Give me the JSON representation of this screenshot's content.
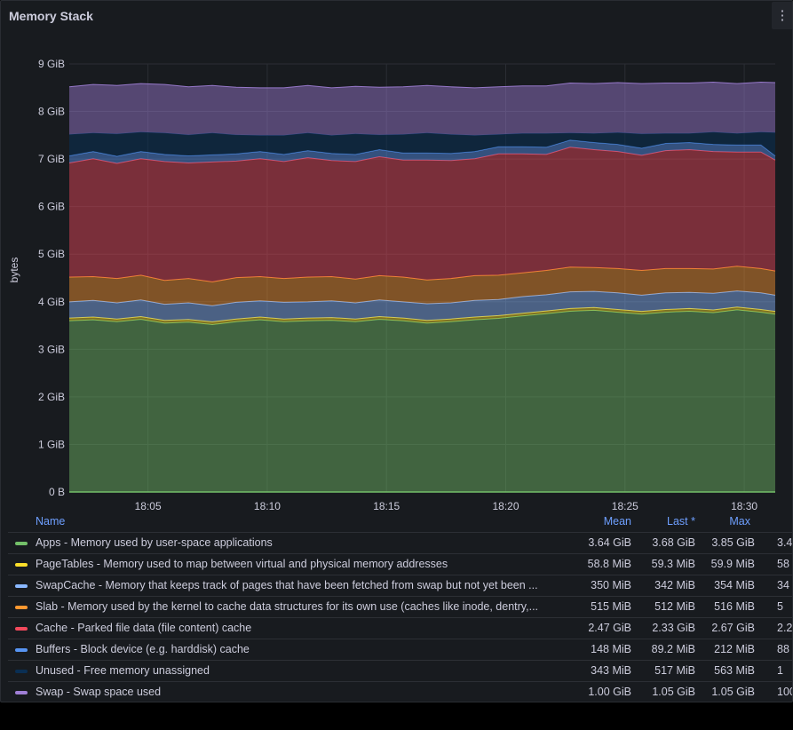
{
  "panel": {
    "title": "Memory Stack",
    "menu_icon": "⋮"
  },
  "chart_data": {
    "type": "area",
    "stacked": true,
    "ylabel": "bytes",
    "yunit": "GiB",
    "ylim": [
      0,
      9
    ],
    "y_ticks": [
      "0 B",
      "1 GiB",
      "2 GiB",
      "3 GiB",
      "4 GiB",
      "5 GiB",
      "6 GiB",
      "7 GiB",
      "8 GiB",
      "9 GiB"
    ],
    "x_ticks": [
      "18:05",
      "18:10",
      "18:15",
      "18:20",
      "18:25",
      "18:30"
    ],
    "x_tick_minutes": [
      65,
      70,
      75,
      80,
      85,
      90
    ],
    "x_range_minutes": [
      61.7,
      91.3
    ],
    "x_minutes": [
      61.7,
      62.7,
      63.7,
      64.7,
      65.7,
      66.7,
      67.7,
      68.7,
      69.7,
      70.7,
      71.7,
      72.7,
      73.7,
      74.7,
      75.7,
      76.7,
      77.7,
      78.7,
      79.7,
      80.7,
      81.7,
      82.7,
      83.7,
      84.7,
      85.7,
      86.7,
      87.7,
      88.7,
      89.7,
      90.7,
      91.3
    ],
    "grid": true,
    "legend_placement": "bottom",
    "series": [
      {
        "name": "Apps - Memory used by user-space applications",
        "color": "#73bf69",
        "values": [
          3.6,
          3.62,
          3.58,
          3.63,
          3.55,
          3.57,
          3.52,
          3.58,
          3.62,
          3.58,
          3.6,
          3.61,
          3.58,
          3.63,
          3.6,
          3.55,
          3.58,
          3.62,
          3.65,
          3.7,
          3.75,
          3.8,
          3.82,
          3.78,
          3.74,
          3.78,
          3.8,
          3.77,
          3.83,
          3.78,
          3.74
        ]
      },
      {
        "name": "PageTables - Memory used to map between virtual and physical memory addresses",
        "color": "#fade2a",
        "values": [
          0.058,
          0.058,
          0.058,
          0.058,
          0.058,
          0.058,
          0.058,
          0.058,
          0.058,
          0.058,
          0.058,
          0.058,
          0.058,
          0.058,
          0.058,
          0.058,
          0.058,
          0.058,
          0.058,
          0.058,
          0.058,
          0.058,
          0.058,
          0.058,
          0.058,
          0.058,
          0.058,
          0.058,
          0.058,
          0.058,
          0.058
        ]
      },
      {
        "name": "SwapCache - Memory that keeps track of pages that have been fetched from swap but not yet been ...",
        "color": "#8ab8ff",
        "values": [
          0.34,
          0.35,
          0.34,
          0.35,
          0.34,
          0.35,
          0.34,
          0.35,
          0.34,
          0.35,
          0.34,
          0.35,
          0.34,
          0.35,
          0.34,
          0.35,
          0.34,
          0.35,
          0.34,
          0.35,
          0.34,
          0.35,
          0.34,
          0.35,
          0.34,
          0.35,
          0.34,
          0.35,
          0.34,
          0.35,
          0.34
        ]
      },
      {
        "name": "Slab - Memory used by the kernel to cache data structures for its own use (caches like inode, dentry,...",
        "color": "#ff9830",
        "values": [
          0.52,
          0.5,
          0.51,
          0.52,
          0.5,
          0.51,
          0.5,
          0.52,
          0.51,
          0.5,
          0.52,
          0.51,
          0.5,
          0.51,
          0.52,
          0.5,
          0.51,
          0.52,
          0.51,
          0.5,
          0.51,
          0.52,
          0.5,
          0.51,
          0.52,
          0.51,
          0.5,
          0.51,
          0.52,
          0.51,
          0.51
        ]
      },
      {
        "name": "Cache - Parked file data (file content) cache",
        "color": "#f2495c",
        "values": [
          2.4,
          2.48,
          2.42,
          2.45,
          2.5,
          2.43,
          2.52,
          2.45,
          2.48,
          2.46,
          2.51,
          2.44,
          2.47,
          2.5,
          2.46,
          2.52,
          2.48,
          2.46,
          2.55,
          2.5,
          2.44,
          2.52,
          2.48,
          2.46,
          2.42,
          2.48,
          2.5,
          2.47,
          2.4,
          2.45,
          2.33
        ]
      },
      {
        "name": "Buffers - Block device (e.g. harddisk) cache",
        "color": "#5794f2",
        "values": [
          0.15,
          0.15,
          0.15,
          0.15,
          0.15,
          0.15,
          0.15,
          0.15,
          0.15,
          0.15,
          0.15,
          0.15,
          0.15,
          0.15,
          0.15,
          0.15,
          0.15,
          0.15,
          0.15,
          0.15,
          0.15,
          0.15,
          0.15,
          0.15,
          0.15,
          0.15,
          0.15,
          0.15,
          0.15,
          0.15,
          0.09
        ]
      },
      {
        "name": "Unused - Free memory unassigned",
        "color": "#0a2f54",
        "values": [
          0.45,
          0.39,
          0.47,
          0.41,
          0.45,
          0.44,
          0.46,
          0.4,
          0.34,
          0.4,
          0.37,
          0.38,
          0.43,
          0.31,
          0.39,
          0.42,
          0.4,
          0.34,
          0.26,
          0.28,
          0.29,
          0.15,
          0.19,
          0.25,
          0.3,
          0.21,
          0.19,
          0.26,
          0.24,
          0.27,
          0.49
        ]
      },
      {
        "name": "Swap - Swap space used",
        "color": "#a07fd6",
        "values": [
          1.0,
          1.02,
          1.02,
          1.02,
          1.02,
          1.01,
          1.0,
          1.0,
          1.0,
          1.0,
          1.0,
          1.0,
          1.0,
          1.0,
          1.0,
          1.0,
          1.0,
          1.0,
          1.0,
          1.0,
          1.0,
          1.05,
          1.05,
          1.05,
          1.06,
          1.06,
          1.06,
          1.05,
          1.05,
          1.05,
          1.05
        ]
      }
    ]
  },
  "legend": {
    "headers": {
      "name": "Name",
      "mean": "Mean",
      "last": "Last *",
      "max": "Max"
    },
    "rows": [
      {
        "color": "#73bf69",
        "name": "Apps - Memory used by user-space applications",
        "mean": "3.64 GiB",
        "last": "3.68 GiB",
        "max": "3.85 GiB",
        "extra": "3.4"
      },
      {
        "color": "#fade2a",
        "name": "PageTables - Memory used to map between virtual and physical memory addresses",
        "mean": "58.8 MiB",
        "last": "59.3 MiB",
        "max": "59.9 MiB",
        "extra": "58"
      },
      {
        "color": "#8ab8ff",
        "name": "SwapCache - Memory that keeps track of pages that have been fetched from swap but not yet been ...",
        "mean": "350 MiB",
        "last": "342 MiB",
        "max": "354 MiB",
        "extra": "34"
      },
      {
        "color": "#ff9830",
        "name": "Slab - Memory used by the kernel to cache data structures for its own use (caches like inode, dentry,...",
        "mean": "515 MiB",
        "last": "512 MiB",
        "max": "516 MiB",
        "extra": "5"
      },
      {
        "color": "#f2495c",
        "name": "Cache - Parked file data (file content) cache",
        "mean": "2.47 GiB",
        "last": "2.33 GiB",
        "max": "2.67 GiB",
        "extra": "2.2"
      },
      {
        "color": "#5794f2",
        "name": "Buffers - Block device (e.g. harddisk) cache",
        "mean": "148 MiB",
        "last": "89.2 MiB",
        "max": "212 MiB",
        "extra": "88"
      },
      {
        "color": "#0a2f54",
        "name": "Unused - Free memory unassigned",
        "mean": "343 MiB",
        "last": "517 MiB",
        "max": "563 MiB",
        "extra": "1"
      },
      {
        "color": "#a07fd6",
        "name": "Swap - Swap space used",
        "mean": "1.00 GiB",
        "last": "1.05 GiB",
        "max": "1.05 GiB",
        "extra": "100"
      }
    ]
  }
}
